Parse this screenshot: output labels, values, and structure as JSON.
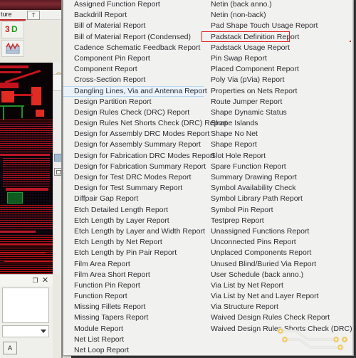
{
  "window": {
    "title": "",
    "menu_bar_label": "ture",
    "tab_button_label": "T",
    "toolbar_icons": [
      "3d-view-icon",
      "waveform-icon"
    ]
  },
  "dock_panel": {
    "float_button_label": "❐",
    "close_button_label": "✕",
    "combo_value": "",
    "combo_arrow_icon": "chevron-down-icon",
    "action_button_label": "A"
  },
  "popup_menu": {
    "name": "reports-menu",
    "hovered_item": "Dangling Lines, Via and Antenna Report",
    "highlighted_item": "Padstack Definition Report",
    "highlight_color": "#e02020",
    "hover_color": "#eaf3fb",
    "background_color": "#f1f1ef",
    "watermark_icon": "pcb-trace-vias-watermark",
    "left_column": [
      "Assigned Function Report",
      "Backdrill Report",
      "Bill of Material Report",
      "Bill of Material Report (Condensed)",
      "Cadence Schematic Feedback Report",
      "Component Pin Report",
      "Component Report",
      "Cross-Section Report",
      "Dangling Lines, Via and Antenna Report",
      "Design Partition Report",
      "Design Rules Check (DRC) Report",
      "Design Rules Net Shorts Check (DRC) Report",
      "Design for Assembly DRC Modes Report",
      "Design for Assembly Summary Report",
      "Design for Fabrication DRC Modes Report",
      "Design for Fabrication Summary Report",
      "Design for Test DRC Modes Report",
      "Design for Test Summary Report",
      "Diffpair Gap Report",
      "Etch Detailed Length Report",
      "Etch Length by Layer Report",
      "Etch Length by Layer and Width Report",
      "Etch Length by Net Report",
      "Etch Length by Pin Pair Report",
      "Film Area Report",
      "Film Area Short Report",
      "Function Pin Report",
      "Function Report",
      "Missing Fillets Report",
      "Missing Tapers Report",
      "Module Report",
      "Net List Report",
      "Net Loop Report"
    ],
    "right_column": [
      "Netin (back anno.)",
      "Netin (non-back)",
      "Pad Shape Touch Usage Report",
      "Padstack Definition Report",
      "Padstack Usage Report",
      "Pin Swap Report",
      "Placed Component Report",
      "Poly Via (pVia) Report",
      "Properties on Nets Report",
      "Route Jumper Report",
      "Shape Dynamic Status",
      "Shape Islands",
      "Shape No Net",
      "Shape Report",
      "Slot Hole Report",
      "Spare Function Report",
      "Summary Drawing Report",
      "Symbol Availability Check",
      "Symbol Library Path Report",
      "Symbol Pin Report",
      "Testprep Report",
      "Unassigned Functions Report",
      "Unconnected Pins Report",
      "Unplaced Components Report",
      "Unused Blind/Buried Via Report",
      "User Schedule (back anno.)",
      "Via List by Net Report",
      "Via List by Net and Layer Report",
      "Via Structure Report",
      "Waived Design Rules Check Report",
      "Waived Design Rules Shorts Check (DRC) Report"
    ]
  }
}
